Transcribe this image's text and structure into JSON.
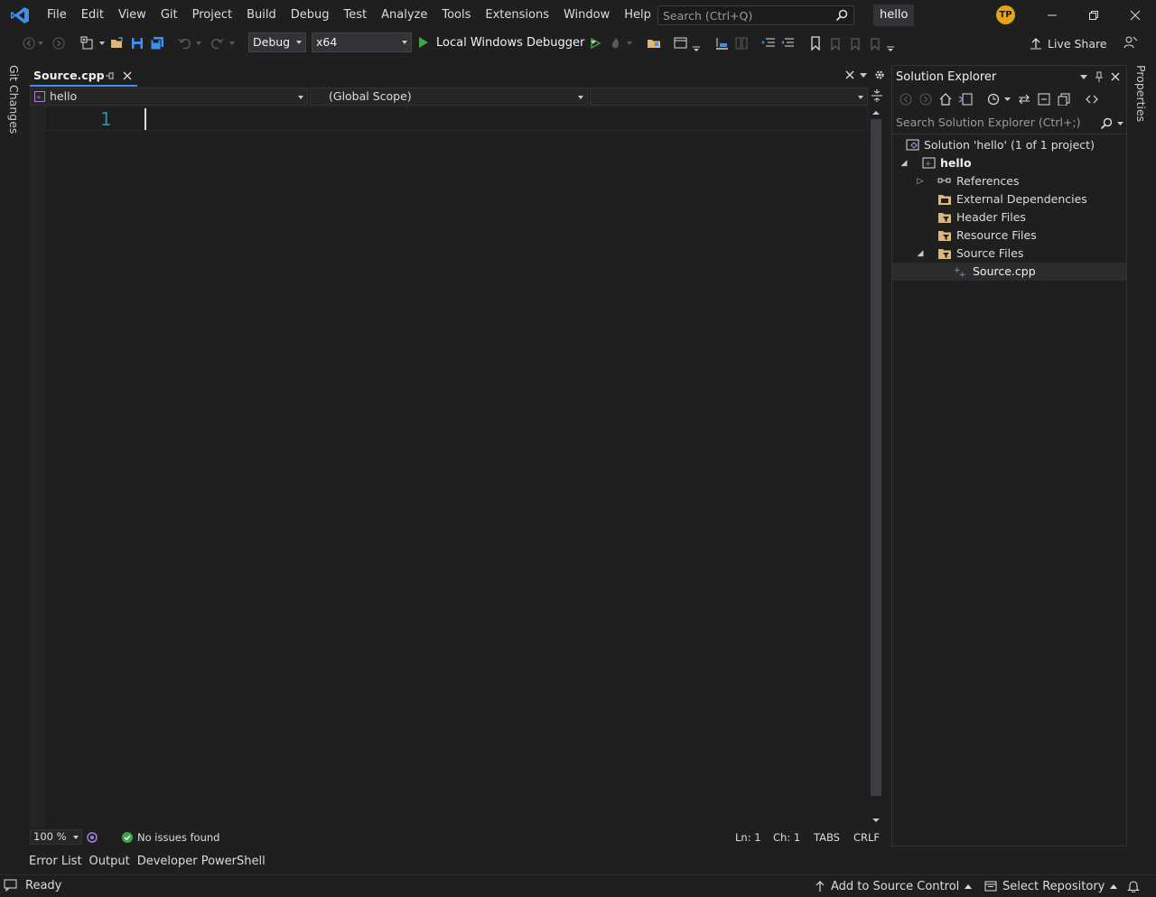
{
  "menu": {
    "items": [
      "File",
      "Edit",
      "View",
      "Git",
      "Project",
      "Build",
      "Debug",
      "Test",
      "Analyze",
      "Tools",
      "Extensions",
      "Window",
      "Help"
    ]
  },
  "titlebar": {
    "search_placeholder": "Search (Ctrl+Q)",
    "solution_name": "hello",
    "avatar_initials": "TP"
  },
  "toolbar": {
    "configuration": "Debug",
    "platform": "x64",
    "debugger": "Local Windows Debugger",
    "live_share": "Live Share"
  },
  "side_tabs": {
    "left": "Git Changes",
    "right": "Properties"
  },
  "editor": {
    "tab_label": "Source.cpp",
    "nav_project": "hello",
    "nav_scope": "(Global Scope)",
    "nav_member": "",
    "line_number": "1",
    "zoom": "100 %",
    "issues": "No issues found",
    "line": "Ln: 1",
    "column": "Ch: 1",
    "indent": "TABS",
    "line_ending": "CRLF"
  },
  "solution_explorer": {
    "title": "Solution Explorer",
    "search_placeholder": "Search Solution Explorer (Ctrl+;)",
    "solution_label": "Solution 'hello' (1 of 1 project)",
    "project": "hello",
    "items": [
      "References",
      "External Dependencies",
      "Header Files",
      "Resource Files",
      "Source Files"
    ],
    "file": "Source.cpp"
  },
  "bottom_tabs": [
    "Error List",
    "Output",
    "Developer PowerShell"
  ],
  "statusbar": {
    "ready": "Ready",
    "source_control": "Add to Source Control",
    "repository": "Select Repository"
  },
  "colors": {
    "accent": "#3f8ef0",
    "vs_purple": "#a97ee0",
    "folder": "#dcb67a",
    "success": "#3fa34d"
  }
}
